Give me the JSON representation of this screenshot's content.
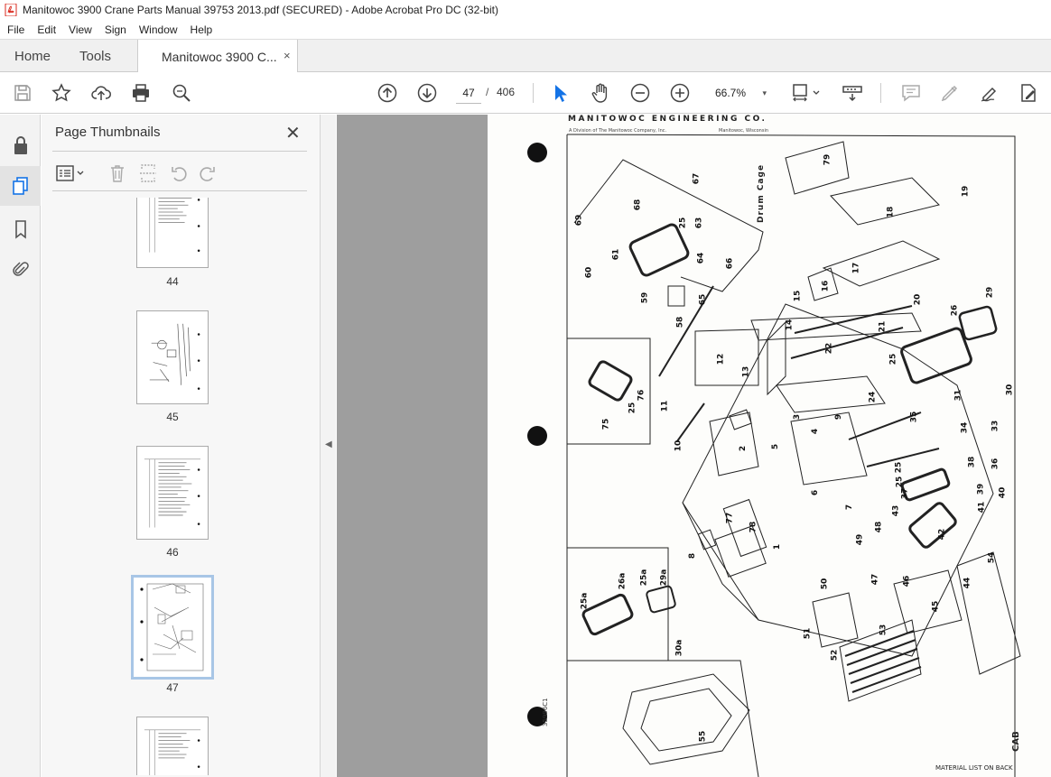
{
  "window": {
    "title": "Manitowoc 3900 Crane Parts Manual 39753 2013.pdf (SECURED) - Adobe Acrobat Pro DC (32-bit)"
  },
  "menu": [
    "File",
    "Edit",
    "View",
    "Sign",
    "Window",
    "Help"
  ],
  "tabs": {
    "home": "Home",
    "tools": "Tools",
    "document": "Manitowoc 3900 C...",
    "close": "×"
  },
  "toolbar": {
    "current_page": "47",
    "page_separator": "/",
    "total_pages": "406",
    "zoom": "66.7%",
    "zoom_caret": "▾"
  },
  "sidebar": {
    "title": "Page Thumbnails",
    "close": "✕",
    "thumbnails": [
      {
        "label": "44"
      },
      {
        "label": "45"
      },
      {
        "label": "46"
      },
      {
        "label": "47",
        "selected": true
      },
      {
        "label": ""
      }
    ]
  },
  "document_page": {
    "header": "MANITOWOC ENGINEERING CO.",
    "subheader_left": "A Division of The Manitowoc Company, Inc.",
    "subheader_right": "Manitowoc, Wisconsin",
    "drum_label": "Drum Cage",
    "side_code": "35996C1",
    "footer": "MATERIAL LIST ON BACK",
    "section": "CAB",
    "part_numbers": [
      "79",
      "68",
      "67",
      "69",
      "61",
      "25",
      "63",
      "18",
      "19",
      "60",
      "64",
      "66",
      "17",
      "59",
      "65",
      "58",
      "16",
      "15",
      "20",
      "14",
      "21",
      "26",
      "29",
      "22",
      "25",
      "12",
      "13",
      "11",
      "75",
      "25",
      "76",
      "30",
      "24",
      "31",
      "3",
      "9",
      "10",
      "2",
      "5",
      "4",
      "34",
      "33",
      "38",
      "36",
      "37",
      "25",
      "39",
      "40",
      "6",
      "7",
      "77",
      "78",
      "1",
      "8",
      "49",
      "48",
      "43",
      "41",
      "42",
      "54",
      "50",
      "47",
      "46",
      "44",
      "45",
      "25a",
      "26a",
      "25a",
      "29a",
      "30a",
      "51",
      "53",
      "52",
      "55",
      "25",
      "35"
    ]
  },
  "colors": {
    "accent": "#1473e6",
    "canvas": "#9e9e9e",
    "thumb_selected": "#a8c6e6",
    "pdf_icon": "#d9281c"
  }
}
